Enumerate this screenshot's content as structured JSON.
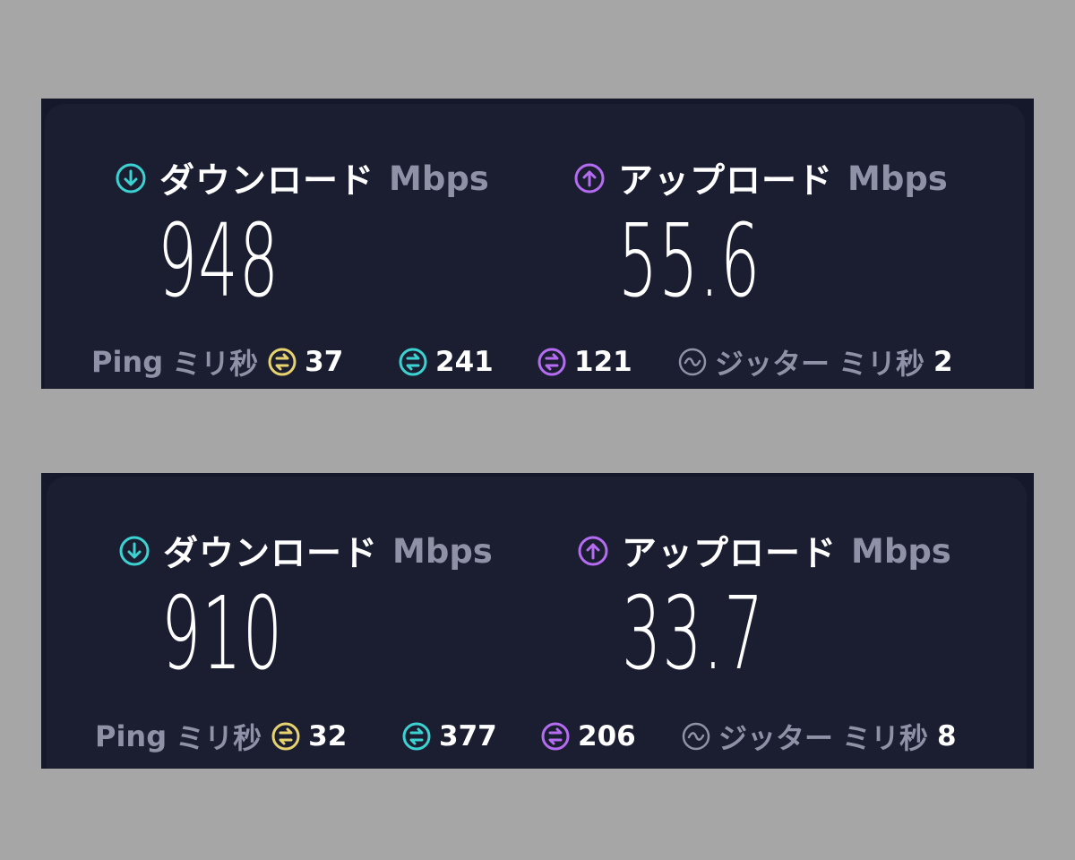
{
  "colors": {
    "background": "#a6a6a6",
    "panel": "#1b1d31",
    "download_accent": "#3cd2d2",
    "upload_accent": "#b46cf0",
    "ping_idle_accent": "#e6d26e",
    "muted_text": "#8f91a6"
  },
  "results": [
    {
      "download": {
        "icon": "arrow-down-circle-icon",
        "label": "ダウンロード",
        "unit": "Mbps",
        "value": "948"
      },
      "upload": {
        "icon": "arrow-up-circle-icon",
        "label": "アップロード",
        "unit": "Mbps",
        "value": "55.6"
      },
      "ping": {
        "label": "Ping",
        "unit": "ミリ秒",
        "idle": "37",
        "download": "241",
        "upload": "121"
      },
      "jitter": {
        "icon": "wave-circle-icon",
        "label": "ジッター",
        "unit": "ミリ秒",
        "value": "2"
      }
    },
    {
      "download": {
        "icon": "arrow-down-circle-icon",
        "label": "ダウンロード",
        "unit": "Mbps",
        "value": "910"
      },
      "upload": {
        "icon": "arrow-up-circle-icon",
        "label": "アップロード",
        "unit": "Mbps",
        "value": "33.7"
      },
      "ping": {
        "label": "Ping",
        "unit": "ミリ秒",
        "idle": "32",
        "download": "377",
        "upload": "206"
      },
      "jitter": {
        "icon": "wave-circle-icon",
        "label": "ジッター",
        "unit": "ミリ秒",
        "value": "8"
      }
    }
  ]
}
